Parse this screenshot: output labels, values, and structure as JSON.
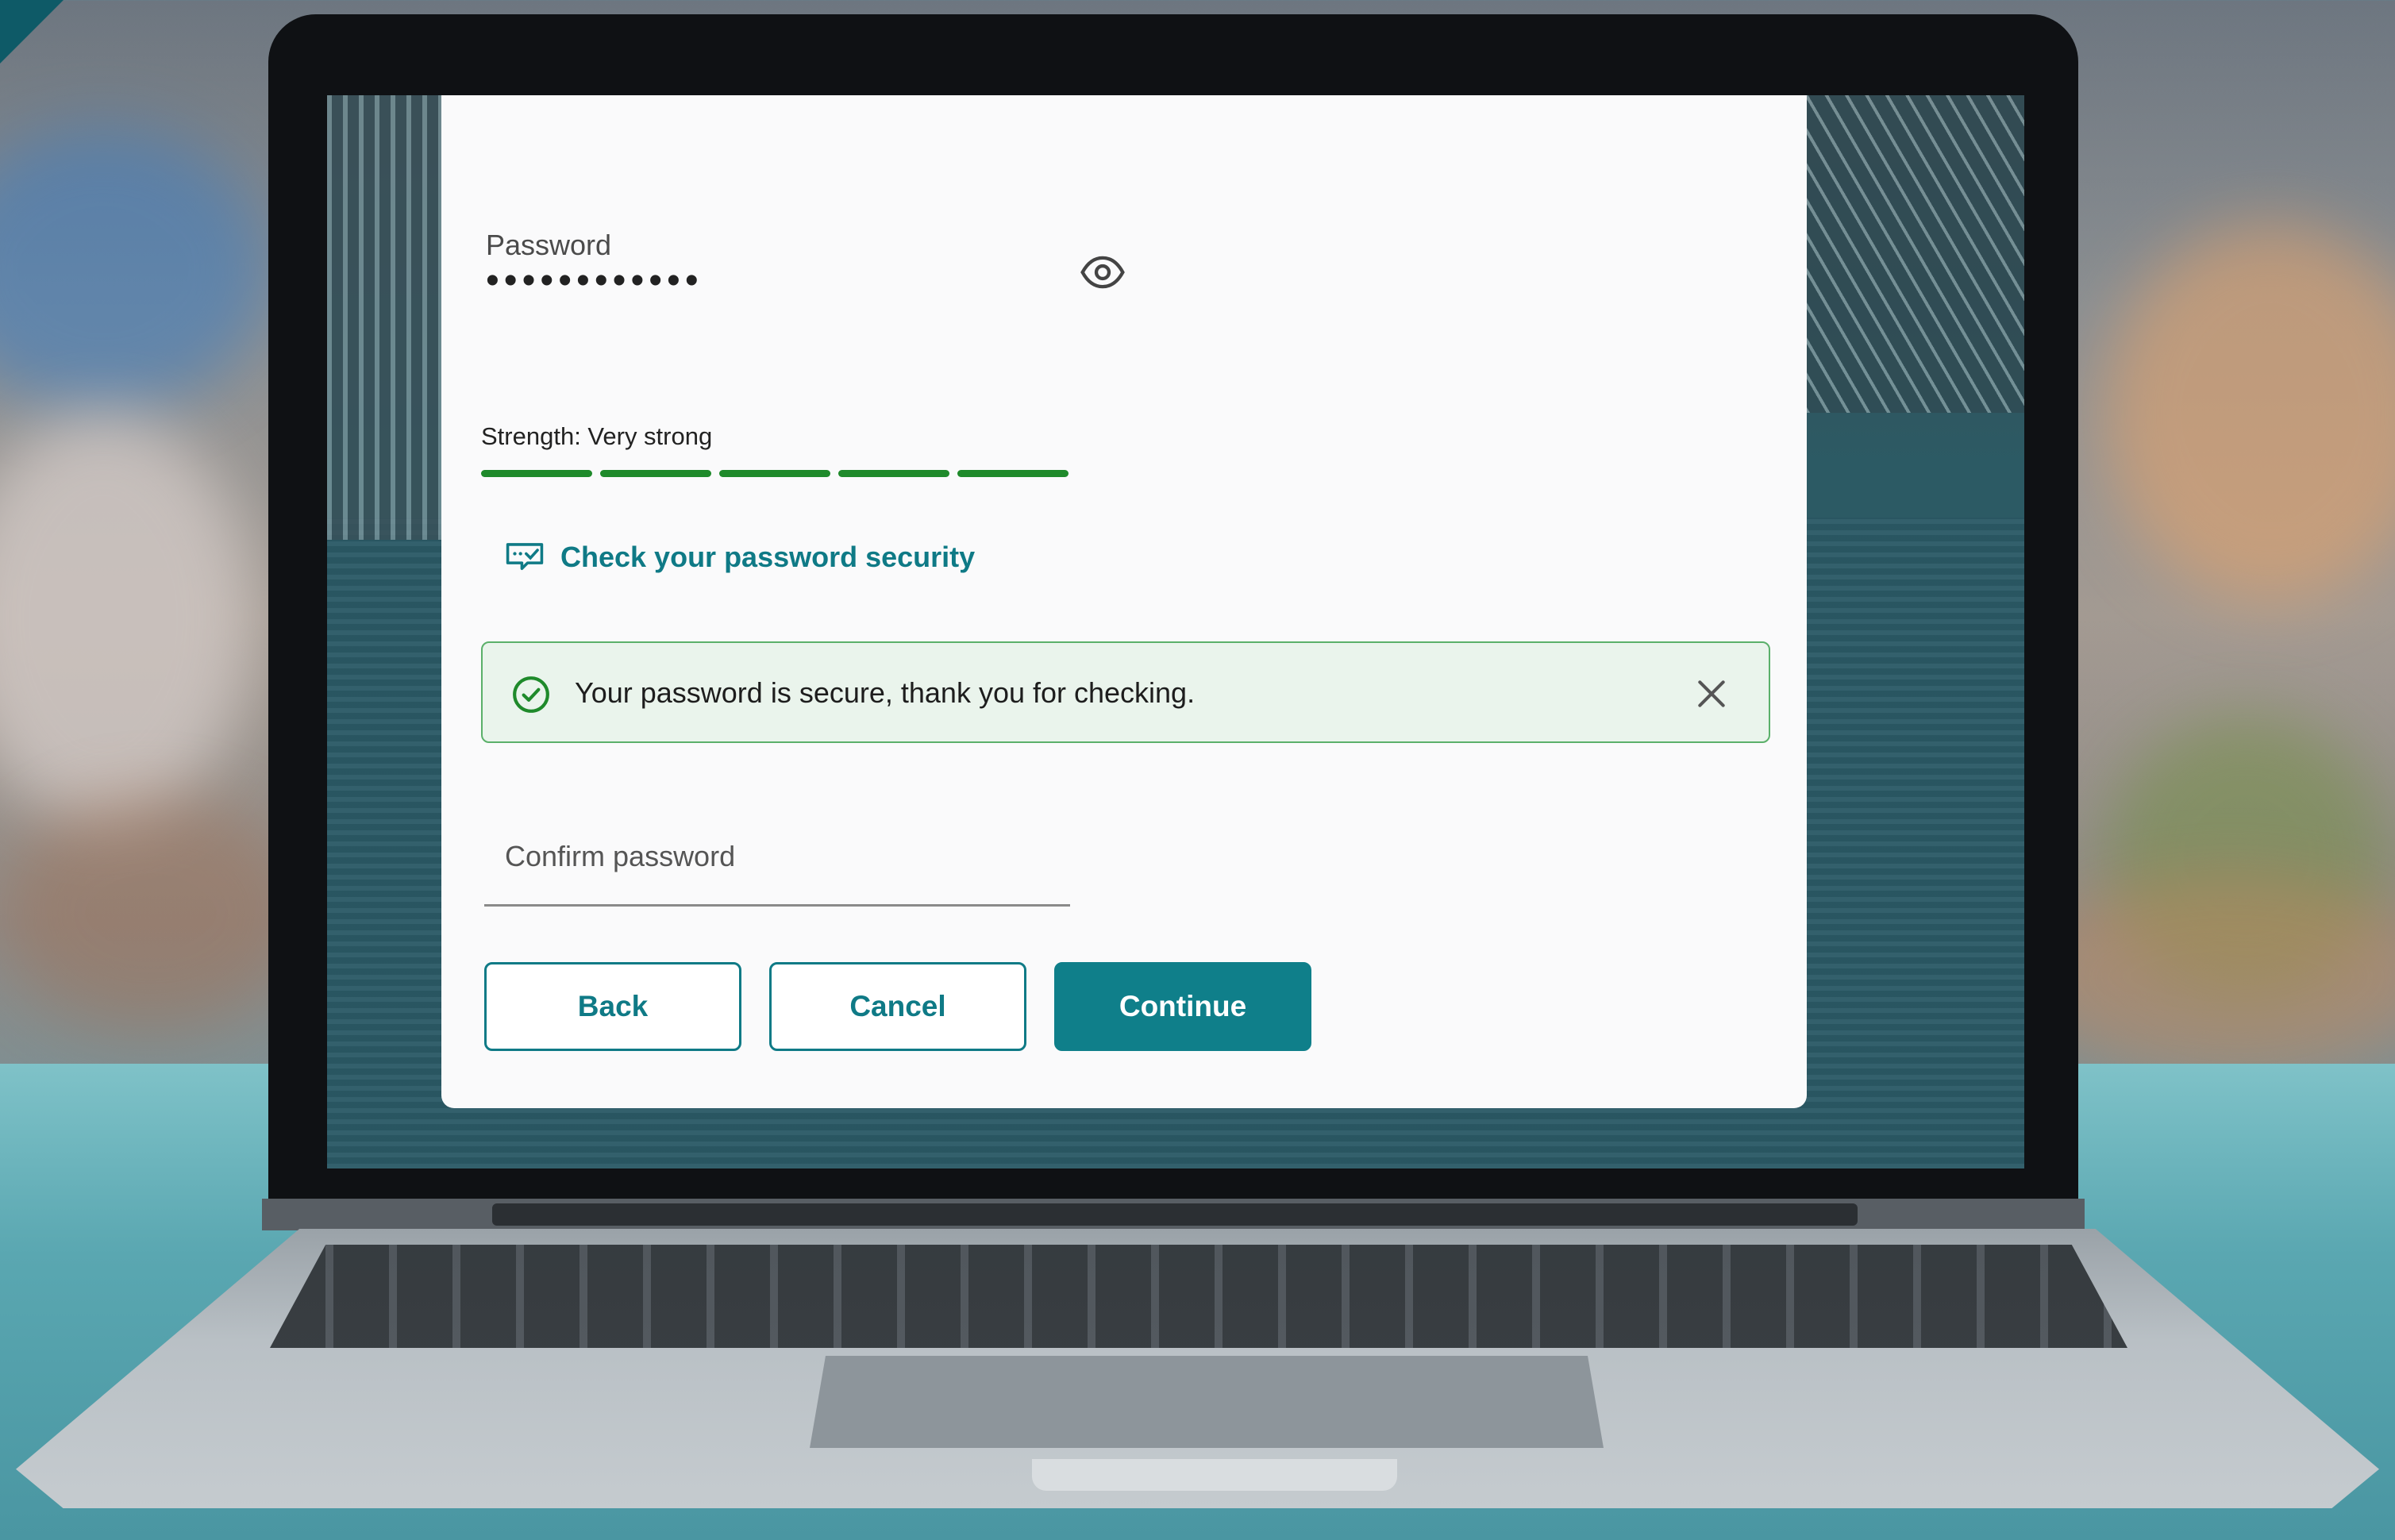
{
  "password": {
    "label": "Password",
    "masked_value": "••••••••••••"
  },
  "strength": {
    "text": "Strength: Very strong",
    "segments_filled": 5,
    "segments_total": 5,
    "color": "#1f8a2b"
  },
  "security_link": {
    "label": "Check your password security",
    "icon": "shield-check-icon"
  },
  "alert": {
    "message": "Your password is secure, thank you for checking.",
    "status_icon": "check-circle-icon",
    "close_icon": "close-icon",
    "bg_color": "#eaf4ec",
    "border_color": "#5bb06a"
  },
  "confirm_password": {
    "placeholder": "Confirm password"
  },
  "buttons": {
    "back": "Back",
    "cancel": "Cancel",
    "continue": "Continue"
  },
  "colors": {
    "accent": "#0f7f8a",
    "link": "#0f7a86"
  }
}
